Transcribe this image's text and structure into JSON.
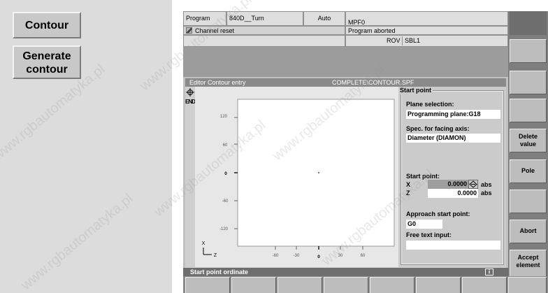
{
  "doc_buttons": {
    "contour": "Contour",
    "generate_line1": "Generate",
    "generate_line2": "contour"
  },
  "header": {
    "program_label": "Program",
    "machine": "840D__Turn",
    "mode": "Auto",
    "program_file": "MPF0",
    "channel_msg": "Channel reset",
    "program_state": "Program aborted",
    "rov": "ROV",
    "sbl": "SBL1"
  },
  "editor": {
    "title": "Editor  Contour entry",
    "path": "COMPLETE\\CONTOUR.SPF"
  },
  "graph": {
    "y_ticks": [
      "120",
      "60",
      "0",
      "-60",
      "-120"
    ],
    "x_ticks": [
      "-60",
      "-30",
      "0",
      "30",
      "60"
    ],
    "axis_x_label": "X",
    "axis_z_label": "Z"
  },
  "params": {
    "group_title": "Start point",
    "plane_label": "Plane selection:",
    "plane_value": "Programming plane:G18",
    "facing_label": "Spec. for facing axis:",
    "facing_value": "Diameter (DIAMON)",
    "start_label": "Start point:",
    "x_name": "X",
    "x_value": "0.0000",
    "x_unit": "abs",
    "z_name": "Z",
    "z_value": "0.0000",
    "z_unit": "abs",
    "approach_label": "Approach start point:",
    "approach_value": "G0",
    "free_text_label": "Free text input:",
    "free_text_value": ""
  },
  "softkeys_vertical": {
    "delete_1": "Delete",
    "delete_2": "value",
    "pole": "Pole",
    "abort": "Abort",
    "accept_1": "Accept",
    "accept_2": "element"
  },
  "status": {
    "text": "Start point ordinate",
    "info": "i"
  },
  "icons": [
    "crosshair-icon",
    "end-icon",
    "pole-toggle-icon",
    "info-icon"
  ],
  "watermark": "www.rgbautomatyka.pl"
}
